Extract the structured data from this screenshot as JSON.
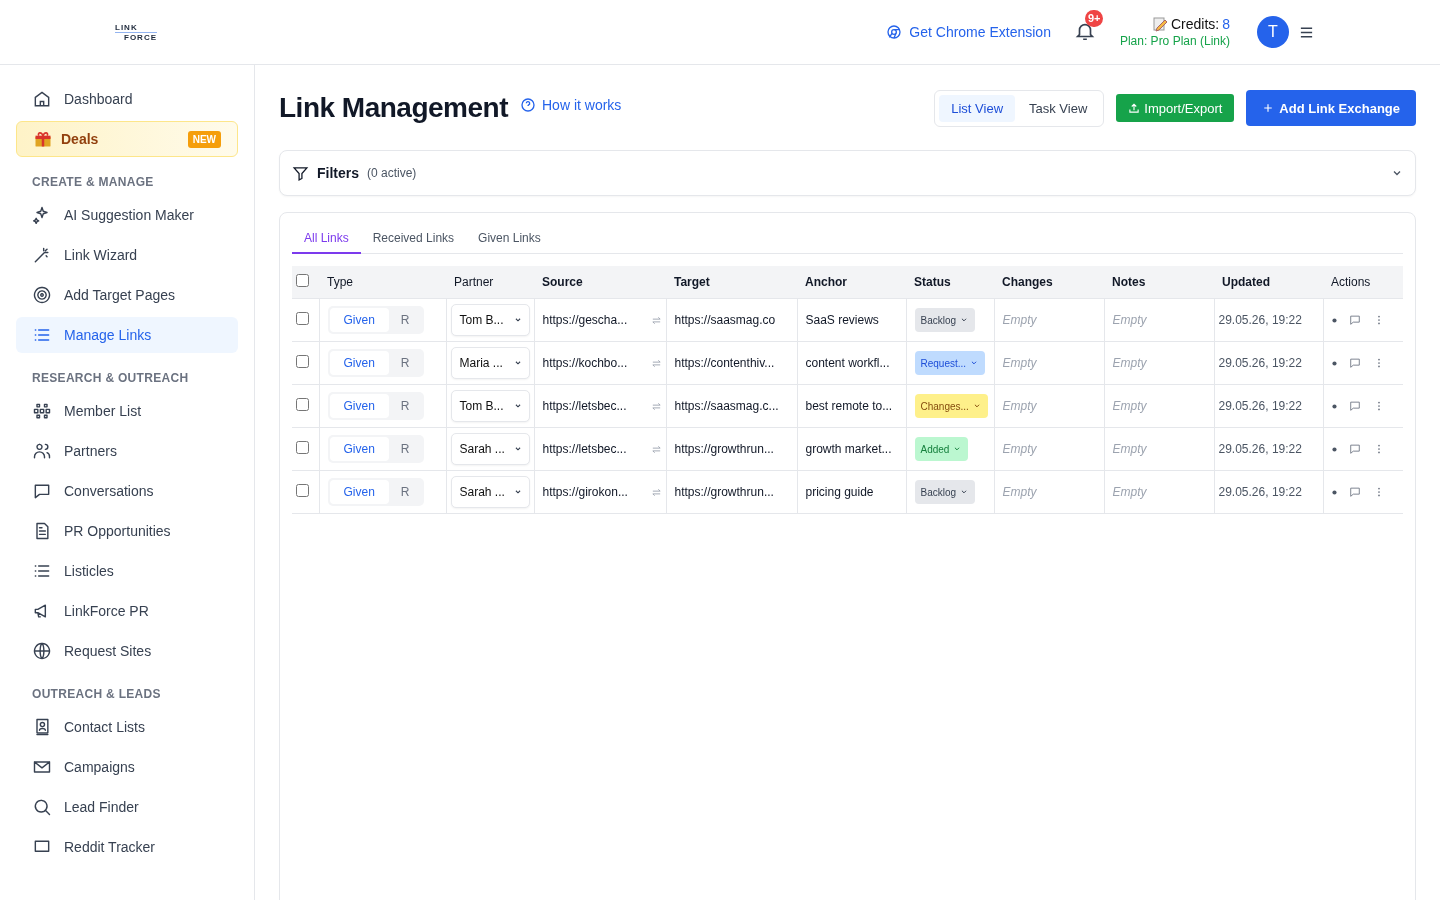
{
  "header": {
    "logo": [
      "LINK",
      "FORCE"
    ],
    "extension_link": "Get Chrome Extension",
    "notification_badge": "9+",
    "credits_label": "Credits:",
    "credits_value": "8",
    "plan": "Plan: Pro Plan (Link)",
    "avatar": "T"
  },
  "sidebar": {
    "top": [
      {
        "label": "Dashboard",
        "selected": false
      },
      {
        "label": "Deals",
        "badge": "NEW"
      }
    ],
    "sections": [
      {
        "title": "CREATE & MANAGE",
        "items": [
          {
            "label": "AI Suggestion Maker",
            "selected": false
          },
          {
            "label": "Link Wizard",
            "selected": false
          },
          {
            "label": "Add Target Pages",
            "selected": false
          },
          {
            "label": "Manage Links",
            "selected": true
          }
        ]
      },
      {
        "title": "RESEARCH & OUTREACH",
        "items": [
          {
            "label": "Member List",
            "selected": false
          },
          {
            "label": "Partners",
            "selected": false
          },
          {
            "label": "Conversations",
            "selected": false
          },
          {
            "label": "PR Opportunities",
            "selected": false
          },
          {
            "label": "Listicles",
            "selected": false
          },
          {
            "label": "LinkForce PR",
            "selected": false
          },
          {
            "label": "Request Sites",
            "selected": false
          }
        ]
      },
      {
        "title": "OUTREACH & LEADS",
        "items": [
          {
            "label": "Contact Lists",
            "selected": false
          },
          {
            "label": "Campaigns",
            "selected": false
          },
          {
            "label": "Lead Finder",
            "selected": false
          },
          {
            "label": "Reddit Tracker",
            "selected": false
          }
        ]
      }
    ]
  },
  "page": {
    "title": "Link Management",
    "help_link": "How it works",
    "views": [
      {
        "label": "List View",
        "selected": true
      },
      {
        "label": "Task View",
        "selected": false
      }
    ],
    "import_button": "Import/Export",
    "add_button": "Add Link Exchange",
    "filters": {
      "label": "Filters",
      "count": "(0 active)",
      "expanded": false
    },
    "tabs": [
      {
        "label": "All Links",
        "selected": true
      },
      {
        "label": "Received Links",
        "selected": false
      },
      {
        "label": "Given Links",
        "selected": false
      }
    ],
    "table": {
      "select_all": false,
      "columns": [
        "Type",
        "Partner",
        "Source",
        "Target",
        "Anchor",
        "Status",
        "Changes",
        "Notes",
        "Updated",
        "Actions"
      ],
      "rows": [
        {
          "checked": false,
          "type": [
            {
              "label": "Given",
              "selected": true
            },
            {
              "label": "R",
              "selected": false
            }
          ],
          "partner": "Tom B...",
          "source": "https://gescha...",
          "target": "https://saasmag.co",
          "anchor": "SaaS reviews",
          "status": {
            "label": "Backlog",
            "kind": "backlog"
          },
          "changes": "Empty",
          "notes": "Empty",
          "updated": "29.05.26, 19:22"
        },
        {
          "checked": false,
          "type": [
            {
              "label": "Given",
              "selected": true
            },
            {
              "label": "R",
              "selected": false
            }
          ],
          "partner": "Maria ...",
          "source": "https://kochbo...",
          "target": "https://contenthiv...",
          "anchor": "content workfl...",
          "status": {
            "label": "Request...",
            "kind": "requested"
          },
          "changes": "Empty",
          "notes": "Empty",
          "updated": "29.05.26, 19:22"
        },
        {
          "checked": false,
          "type": [
            {
              "label": "Given",
              "selected": true
            },
            {
              "label": "R",
              "selected": false
            }
          ],
          "partner": "Tom B...",
          "source": "https://letsbec...",
          "target": "https://saasmag.c...",
          "anchor": "best remote to...",
          "status": {
            "label": "Changes...",
            "kind": "changes"
          },
          "changes": "Empty",
          "notes": "Empty",
          "updated": "29.05.26, 19:22"
        },
        {
          "checked": false,
          "type": [
            {
              "label": "Given",
              "selected": true
            },
            {
              "label": "R",
              "selected": false
            }
          ],
          "partner": "Sarah ...",
          "source": "https://letsbec...",
          "target": "https://growthrun...",
          "anchor": "growth market...",
          "status": {
            "label": "Added",
            "kind": "added"
          },
          "changes": "Empty",
          "notes": "Empty",
          "updated": "29.05.26, 19:22"
        },
        {
          "checked": false,
          "type": [
            {
              "label": "Given",
              "selected": true
            },
            {
              "label": "R",
              "selected": false
            }
          ],
          "partner": "Sarah ...",
          "source": "https://girokon...",
          "target": "https://growthrun...",
          "anchor": "pricing guide",
          "status": {
            "label": "Backlog",
            "kind": "backlog"
          },
          "changes": "Empty",
          "notes": "Empty",
          "updated": "29.05.26, 19:22"
        }
      ]
    }
  }
}
